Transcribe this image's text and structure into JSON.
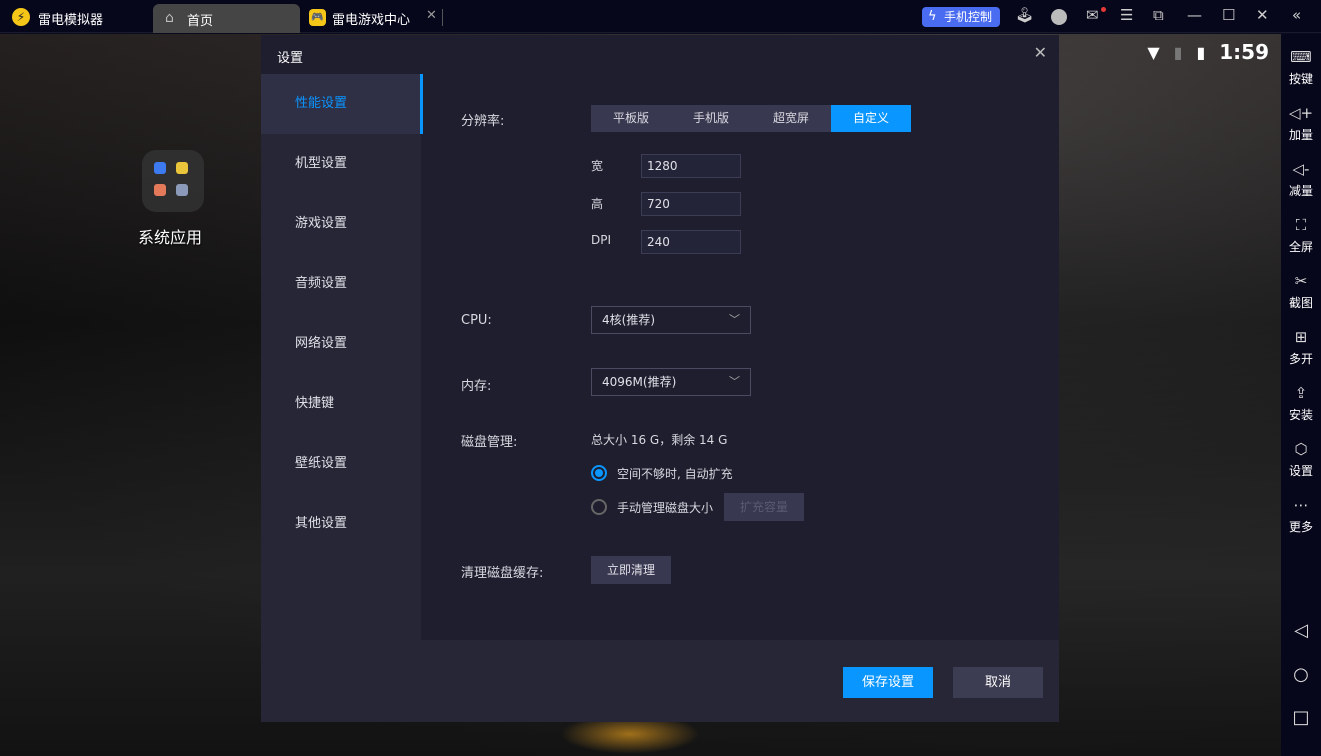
{
  "topbar": {
    "app_name": "雷电模拟器",
    "tabs": [
      {
        "label": "首页"
      },
      {
        "label": "雷电游戏中心"
      }
    ],
    "phone_control": "手机控制"
  },
  "android": {
    "time": "1:59",
    "folder_name": "系统应用"
  },
  "right_bar": {
    "items": [
      {
        "label": "按键",
        "icon": "keyboard-icon"
      },
      {
        "label": "加量",
        "icon": "volume-up-icon"
      },
      {
        "label": "减量",
        "icon": "volume-down-icon"
      },
      {
        "label": "全屏",
        "icon": "fullscreen-icon"
      },
      {
        "label": "截图",
        "icon": "scissors-icon"
      },
      {
        "label": "多开",
        "icon": "multi-instance-icon"
      },
      {
        "label": "安装",
        "icon": "apk-install-icon"
      },
      {
        "label": "设置",
        "icon": "settings-icon"
      },
      {
        "label": "更多",
        "icon": "more-icon"
      }
    ]
  },
  "dialog": {
    "title": "设置",
    "nav": [
      {
        "label": "性能设置",
        "active": true
      },
      {
        "label": "机型设置"
      },
      {
        "label": "游戏设置"
      },
      {
        "label": "音频设置"
      },
      {
        "label": "网络设置"
      },
      {
        "label": "快捷键"
      },
      {
        "label": "壁纸设置"
      },
      {
        "label": "其他设置"
      }
    ],
    "resolution": {
      "label": "分辨率:",
      "options": [
        "平板版",
        "手机版",
        "超宽屏",
        "自定义"
      ],
      "selected": "自定义",
      "width_label": "宽",
      "width": "1280",
      "height_label": "高",
      "height": "720",
      "dpi_label": "DPI",
      "dpi": "240"
    },
    "cpu": {
      "label": "CPU:",
      "value": "4核(推荐)"
    },
    "memory": {
      "label": "内存:",
      "value": "4096M(推荐)"
    },
    "disk": {
      "label": "磁盘管理:",
      "info": "总大小 16 G，剩余 14 G",
      "option_auto": "空间不够时, 自动扩充",
      "option_manual": "手动管理磁盘大小",
      "expand_button": "扩充容量",
      "selected": "auto"
    },
    "cache": {
      "label": "清理磁盘缓存:",
      "button": "立即清理"
    },
    "save": "保存设置",
    "cancel": "取消"
  },
  "colors": {
    "accent": "#0a96ff",
    "phone_control": "#4a6cf0",
    "logo": "#f5c518"
  }
}
